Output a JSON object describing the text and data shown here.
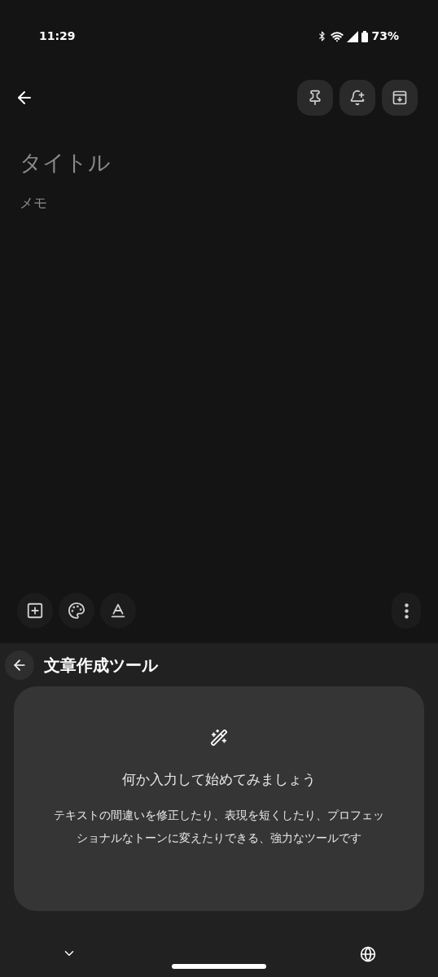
{
  "status_bar": {
    "time": "11:29",
    "battery": "73%"
  },
  "note": {
    "title_placeholder": "タイトル",
    "body_placeholder": "メモ"
  },
  "writing_tools": {
    "title": "文章作成ツール",
    "heading": "何か入力して始めてみましょう",
    "description": "テキストの間違いを修正したり、表現を短くしたり、プロフェッショナルなトーンに変えたりできる、強力なツールです"
  }
}
